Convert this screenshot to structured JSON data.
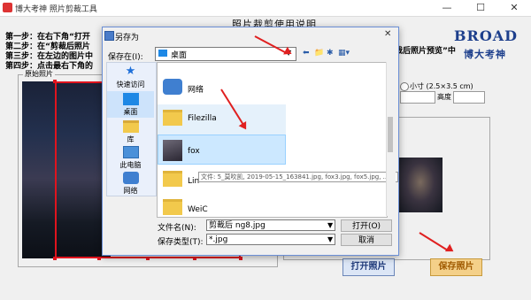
{
  "app": {
    "title": "博大考神 照片剪裁工具",
    "heading": "照片裁剪使用说明",
    "window_controls": [
      "—",
      "☐",
      "✕"
    ],
    "steps": [
      "第一步：在右下角“打开",
      "第二步：在“剪裁后照片",
      "第三步：在左边的图片中",
      "第四步：点击最右下角的"
    ],
    "step_tail": "裁后照片预览”中",
    "logo_en": "BROAD",
    "logo_cn": "博大考神",
    "original_photo_label": "原始照片",
    "size_option": "小寸 (2.5×3.5 cm)",
    "height_label": "高度",
    "open_photo_button": "打开照片",
    "save_photo_button": "保存照片"
  },
  "dialog": {
    "title": "另存为",
    "close_glyph": "✕",
    "save_in_label": "保存在(I):",
    "location": "桌面",
    "toolbar_glyphs": [
      "⬅",
      "📁",
      "✱",
      "▦▾"
    ],
    "places": [
      {
        "label": "快速访问",
        "icon": "star-icon"
      },
      {
        "label": "桌面",
        "icon": "desktop-icon"
      },
      {
        "label": "库",
        "icon": "library-icon"
      },
      {
        "label": "此电脑",
        "icon": "computer-icon"
      },
      {
        "label": "网络",
        "icon": "network-icon"
      }
    ],
    "files": [
      {
        "name": "网络",
        "icon": "network-icon"
      },
      {
        "name": "Filezilla",
        "icon": "folder-icon"
      },
      {
        "name": "fox",
        "icon": "image-icon"
      },
      {
        "name": "Lin",
        "icon": "folder-icon"
      },
      {
        "name": "WeiC",
        "icon": "folder-icon"
      }
    ],
    "tooltip": "文件: 5_莫吹凯, 2019-05-15_163841.jpg, fox3.jpg, fox5.jpg, ...",
    "filename_label": "文件名(N):",
    "filename_value": "剪裁后 ng8.jpg",
    "filetype_label": "保存类型(T):",
    "filetype_value": "*.jpg",
    "open_button": "打开(O)",
    "cancel_button": "取消"
  },
  "colors": {
    "accent_red": "#e02020",
    "logo_blue": "#1d3f8c",
    "dialog_border": "#6b8fd6",
    "selection": "#cce8ff"
  }
}
